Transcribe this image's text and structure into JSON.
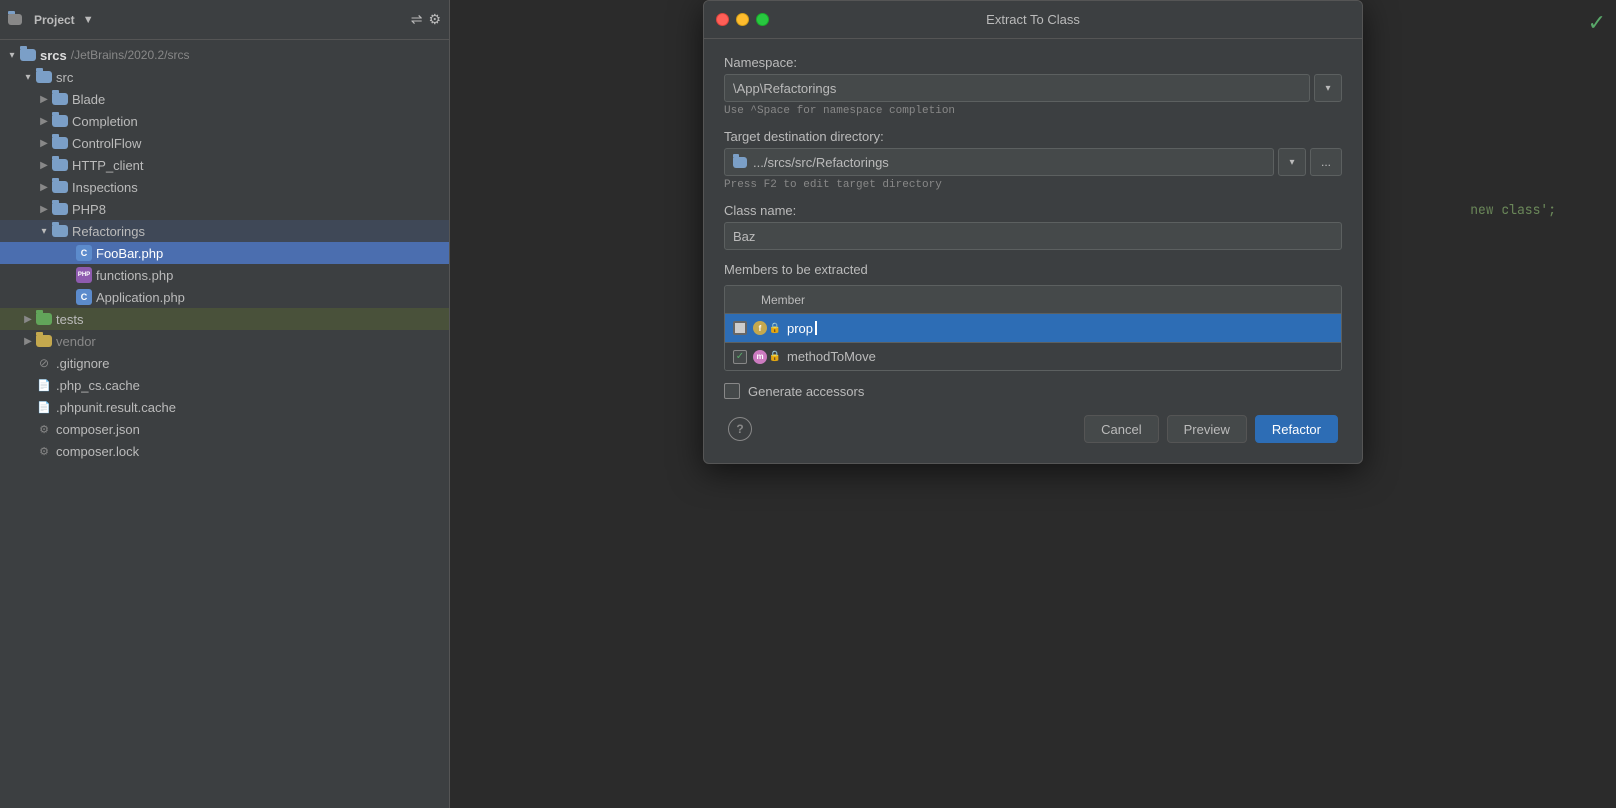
{
  "sidebar": {
    "toolbar": {
      "title": "Project",
      "dropdown_arrow": "▼"
    },
    "root": {
      "label": "srcs",
      "path": "/JetBrains/2020.2/srcs"
    },
    "tree": [
      {
        "id": "srcs",
        "label": "srcs",
        "path": "/JetBrains/2020.2/srcs",
        "type": "root",
        "open": true,
        "depth": 0
      },
      {
        "id": "src",
        "label": "src",
        "type": "folder",
        "open": true,
        "depth": 1
      },
      {
        "id": "Blade",
        "label": "Blade",
        "type": "folder",
        "open": false,
        "depth": 2
      },
      {
        "id": "Completion",
        "label": "Completion",
        "type": "folder",
        "open": false,
        "depth": 2
      },
      {
        "id": "ControlFlow",
        "label": "ControlFlow",
        "type": "folder",
        "open": false,
        "depth": 2
      },
      {
        "id": "HTTP_client",
        "label": "HTTP_client",
        "type": "folder",
        "open": false,
        "depth": 2
      },
      {
        "id": "Inspections",
        "label": "Inspections",
        "type": "folder",
        "open": false,
        "depth": 2
      },
      {
        "id": "PHP8",
        "label": "PHP8",
        "type": "folder",
        "open": false,
        "depth": 2
      },
      {
        "id": "Refactorings",
        "label": "Refactorings",
        "type": "folder",
        "open": true,
        "depth": 2,
        "selected": true
      },
      {
        "id": "FooBar.php",
        "label": "FooBar.php",
        "type": "file-c",
        "depth": 3,
        "selected": true
      },
      {
        "id": "functions.php",
        "label": "functions.php",
        "type": "file-php",
        "depth": 3
      },
      {
        "id": "Application.php",
        "label": "Application.php",
        "type": "file-c",
        "depth": 3
      },
      {
        "id": "tests",
        "label": "tests",
        "type": "folder-green",
        "open": false,
        "depth": 1,
        "highlighted": true
      },
      {
        "id": "vendor",
        "label": "vendor",
        "type": "folder-yellow",
        "open": false,
        "depth": 1
      },
      {
        "id": ".gitignore",
        "label": ".gitignore",
        "type": "file-generic",
        "icon": "⊘",
        "depth": 1
      },
      {
        "id": ".php_cs.cache",
        "label": ".php_cs.cache",
        "type": "file-generic",
        "icon": "📄",
        "depth": 1
      },
      {
        "id": ".phpunit.result.cache",
        "label": ".phpunit.result.cache",
        "type": "file-generic",
        "icon": "📄",
        "depth": 1
      },
      {
        "id": "composer.json",
        "label": "composer.json",
        "type": "file-generic",
        "icon": "⚙",
        "depth": 1
      },
      {
        "id": "composer.lock",
        "label": "composer.lock",
        "type": "file-generic",
        "icon": "⚙",
        "depth": 1
      }
    ]
  },
  "dialog": {
    "title": "Extract To Class",
    "namespace_label": "Namespace:",
    "namespace_value": "\\App\\Refactorings",
    "namespace_hint": "Use ^Space for namespace completion",
    "target_dir_label": "Target destination directory:",
    "target_dir_value": ".../srcs/src/Refactorings",
    "target_dir_hint": "Press F2 to edit target directory",
    "class_name_label": "Class name:",
    "class_name_value": "Baz",
    "members_title": "Members to be extracted",
    "members_col": "Member",
    "members": [
      {
        "id": "prop",
        "name": "prop",
        "checked": false,
        "type": "f",
        "selected": true
      },
      {
        "id": "methodToMove",
        "name": "methodToMove",
        "checked": true,
        "type": "m",
        "selected": false
      }
    ],
    "generate_accessors_label": "Generate accessors",
    "buttons": {
      "help": "?",
      "cancel": "Cancel",
      "preview": "Preview",
      "refactor": "Refactor"
    }
  },
  "editor": {
    "line1": "new class';",
    "checkmark": "✓"
  }
}
